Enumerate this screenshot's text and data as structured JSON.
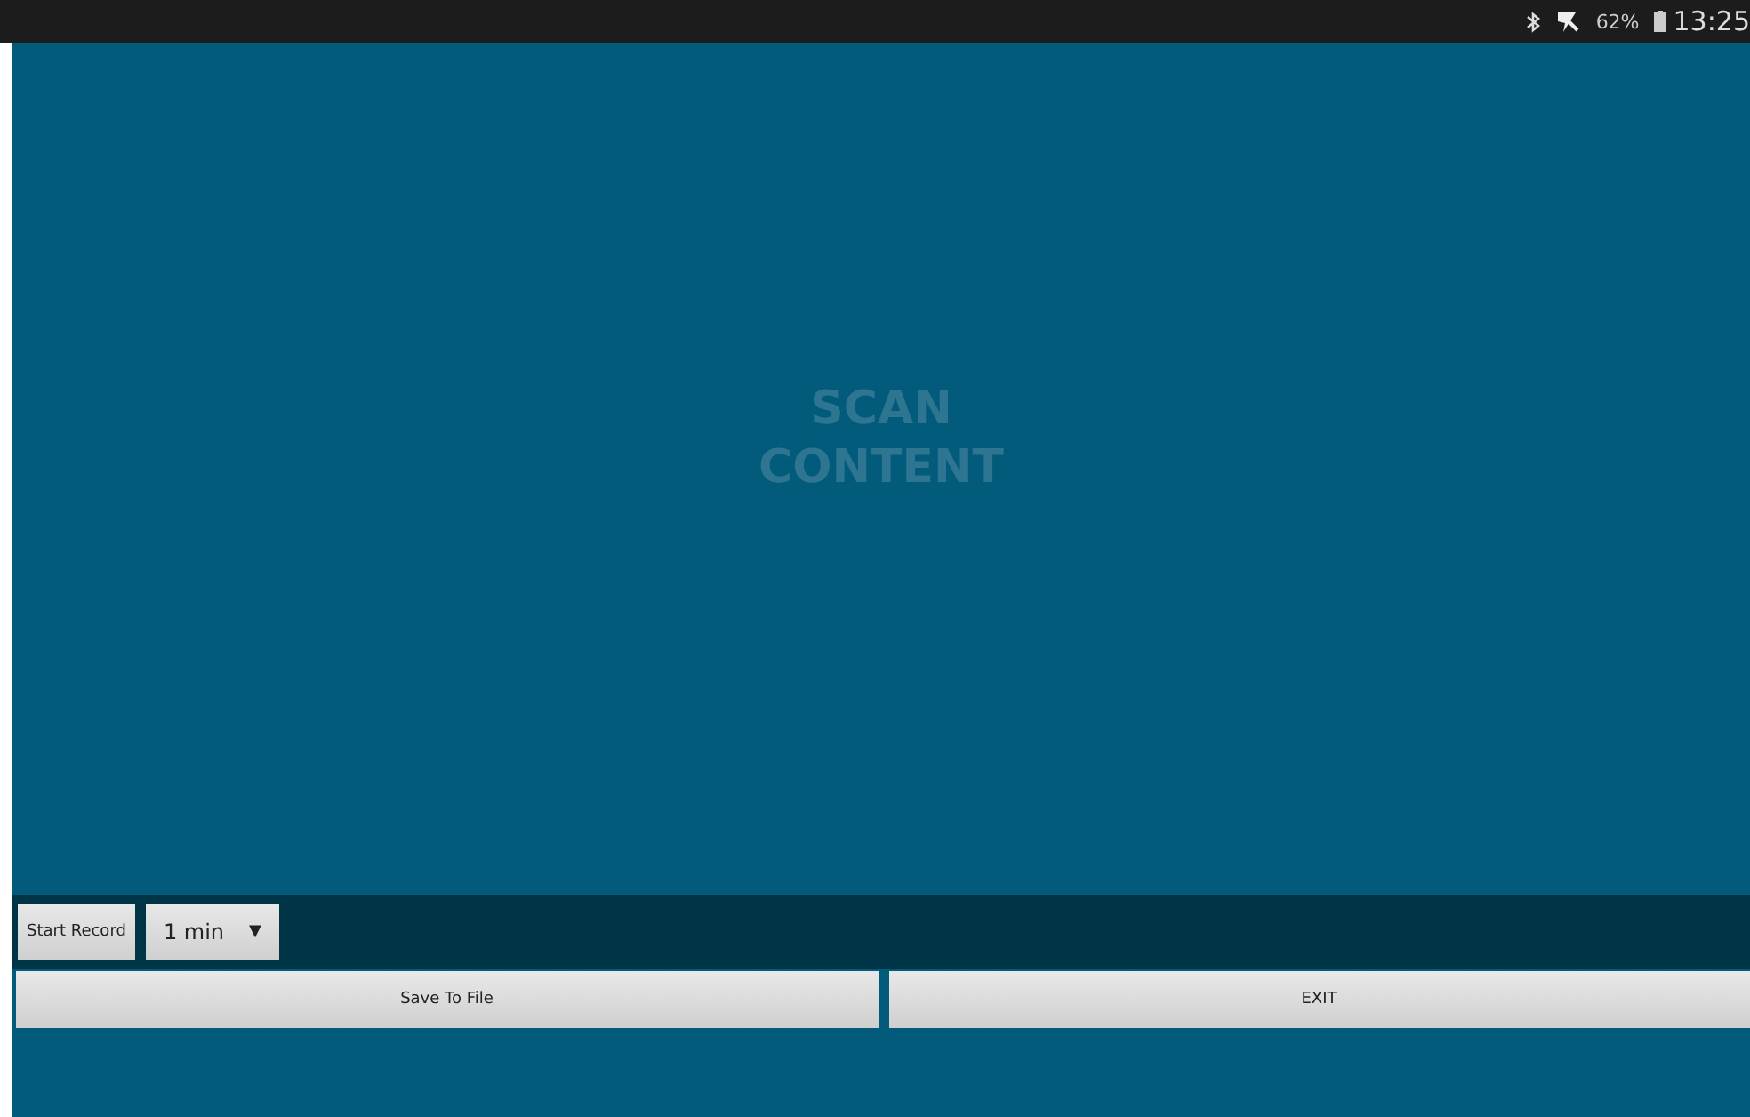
{
  "status_bar": {
    "battery": "62%",
    "time": "13:25"
  },
  "content": {
    "label_lines": [
      "SCAN",
      "CONTENT"
    ]
  },
  "record_bar": {
    "record_button": "Start Record",
    "duration": {
      "value": "1 min",
      "caret": "▼"
    }
  },
  "buttons": [
    "Save To File",
    "EXIT"
  ]
}
